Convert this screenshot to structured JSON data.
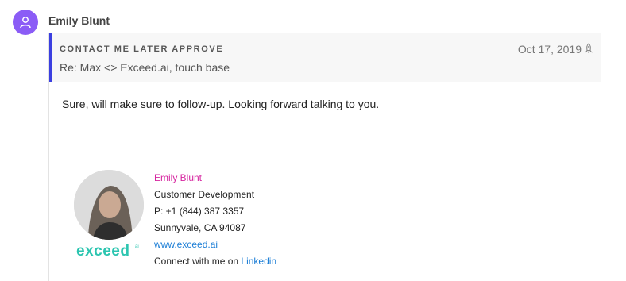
{
  "sender": {
    "name": "Emily Blunt",
    "avatar_icon": "user-icon",
    "avatar_color": "#8b5cf6"
  },
  "message": {
    "tag": "CONTACT ME LATER APPROVE",
    "subject": "Re: Max <> Exceed.ai, touch base",
    "date": "Oct 17, 2019",
    "status_icon": "rocket-icon",
    "accent_color": "#3b3fe0",
    "body": "Sure, will make sure to follow-up. Looking forward talking to you."
  },
  "signature": {
    "name": "Emily Blunt",
    "title": "Customer Development",
    "phone": "P: +1 (844) 387 3357",
    "location": "Sunnyvale, CA 94087",
    "website": "www.exceed.ai",
    "connect_prefix": "Connect with me on ",
    "connect_link": "Linkedin",
    "logo_text": "exceed",
    "logo_suffix": "ai"
  }
}
